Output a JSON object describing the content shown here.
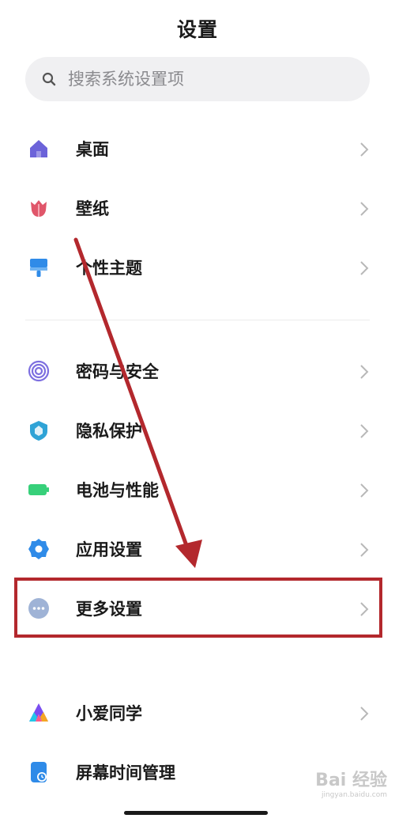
{
  "header": {
    "title": "设置"
  },
  "search": {
    "placeholder": "搜索系统设置项",
    "icon": "search-icon"
  },
  "groups": [
    {
      "items": [
        {
          "label": "桌面",
          "icon": "home-icon",
          "color": "#6c63d9"
        },
        {
          "label": "壁纸",
          "icon": "tulip-icon",
          "color": "#e0566a"
        },
        {
          "label": "个性主题",
          "icon": "paint-brush-icon",
          "color": "#2f8be8"
        }
      ]
    },
    {
      "items": [
        {
          "label": "密码与安全",
          "icon": "fingerprint-icon",
          "color": "#7d6fe0"
        },
        {
          "label": "隐私保护",
          "icon": "shield-icon",
          "color": "#2fa3d6"
        },
        {
          "label": "电池与性能",
          "icon": "battery-icon",
          "color": "#37d07a"
        },
        {
          "label": "应用设置",
          "icon": "gear-icon",
          "color": "#2f8be8"
        },
        {
          "label": "更多设置",
          "icon": "more-dots-icon",
          "color": "#9fb3d6"
        }
      ]
    },
    {
      "items": [
        {
          "label": "小爱同学",
          "icon": "xiaoai-icon",
          "color": "#7a4df0"
        },
        {
          "label": "屏幕时间管理",
          "icon": "screen-time-icon",
          "color": "#2f8be8"
        }
      ]
    }
  ],
  "annotation": {
    "highlight_color": "#b3282d",
    "highlighted_item": "更多设置"
  },
  "watermark": {
    "main": "Bai 经验",
    "sub": "jingyan.baidu.com"
  }
}
